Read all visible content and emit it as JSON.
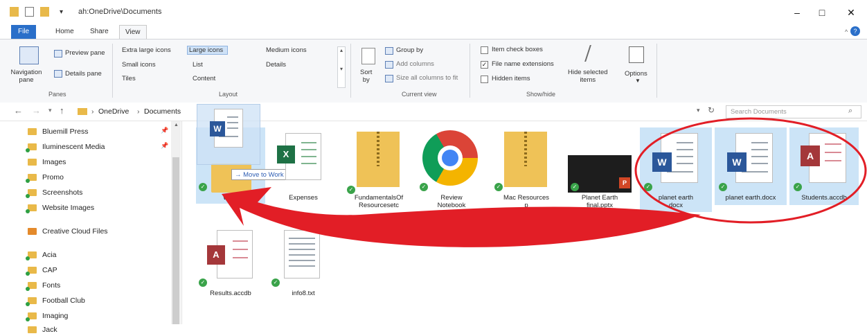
{
  "title_bar": {
    "path": "ah:OneDrive\\Documents",
    "quick_access": [
      "folder-icon",
      "save-icon",
      "folder-icon"
    ],
    "buttons": [
      "minimize",
      "maximize",
      "close"
    ]
  },
  "tabs": [
    "File",
    "Home",
    "Share",
    "View"
  ],
  "ribbon": {
    "panes": {
      "navigation_pane": "Navigation\npane",
      "preview_pane": "Preview pane",
      "details_pane": "Details pane",
      "group": "Panes"
    },
    "layout": {
      "extra_large": "Extra large icons",
      "large": "Large icons",
      "medium": "Medium icons",
      "small": "Small icons",
      "list": "List",
      "details": "Details",
      "tiles": "Tiles",
      "content": "Content",
      "group": "Layout"
    },
    "current_view": {
      "sort_by": "Sort\nby",
      "group_by": "Group by",
      "add_columns": "Add columns",
      "size_all": "Size all columns to fit",
      "group": "Current view"
    },
    "show_hide": {
      "item_check_boxes": "Item check boxes",
      "file_name_extensions": "File name extensions",
      "hidden_items": "Hidden items",
      "hide_selected": "Hide selected\nitems",
      "options": "Options",
      "group": "Show/hide"
    }
  },
  "address": {
    "crumbs": [
      "OneDrive",
      "Documents"
    ],
    "search_placeholder": "Search Documents"
  },
  "nav_items": [
    "Bluemill Press",
    "Iluminescent Media",
    "Images",
    "Promo",
    "Screenshots",
    "Website Images",
    "Creative Cloud Files",
    "Acia",
    "CAP",
    "Fonts",
    "Football Club",
    "Imaging",
    "Jack"
  ],
  "drag_tooltip": "Move to Work",
  "files": [
    {
      "name": "Work",
      "type": "folder"
    },
    {
      "name": "Expenses",
      "type": "excel"
    },
    {
      "name": "FundamentalsOf\nResourcesetc",
      "type": "zip"
    },
    {
      "name": "Review\nNotebook",
      "type": "chrome"
    },
    {
      "name": "Mac Resources\np",
      "type": "zip"
    },
    {
      "name": "Planet Earth\nfinal.pptx",
      "type": "ppt"
    },
    {
      "name": "planet earth\ndocx",
      "type": "word"
    },
    {
      "name": "planet earth.docx",
      "type": "word"
    },
    {
      "name": "Students.accdb",
      "type": "access"
    },
    {
      "name": "Results.accdb",
      "type": "access"
    },
    {
      "name": "info8.txt",
      "type": "txt"
    }
  ],
  "colors": {
    "accent": "#2a6fc9",
    "annotation": "#e21e26",
    "selection": "#cce4f7"
  }
}
